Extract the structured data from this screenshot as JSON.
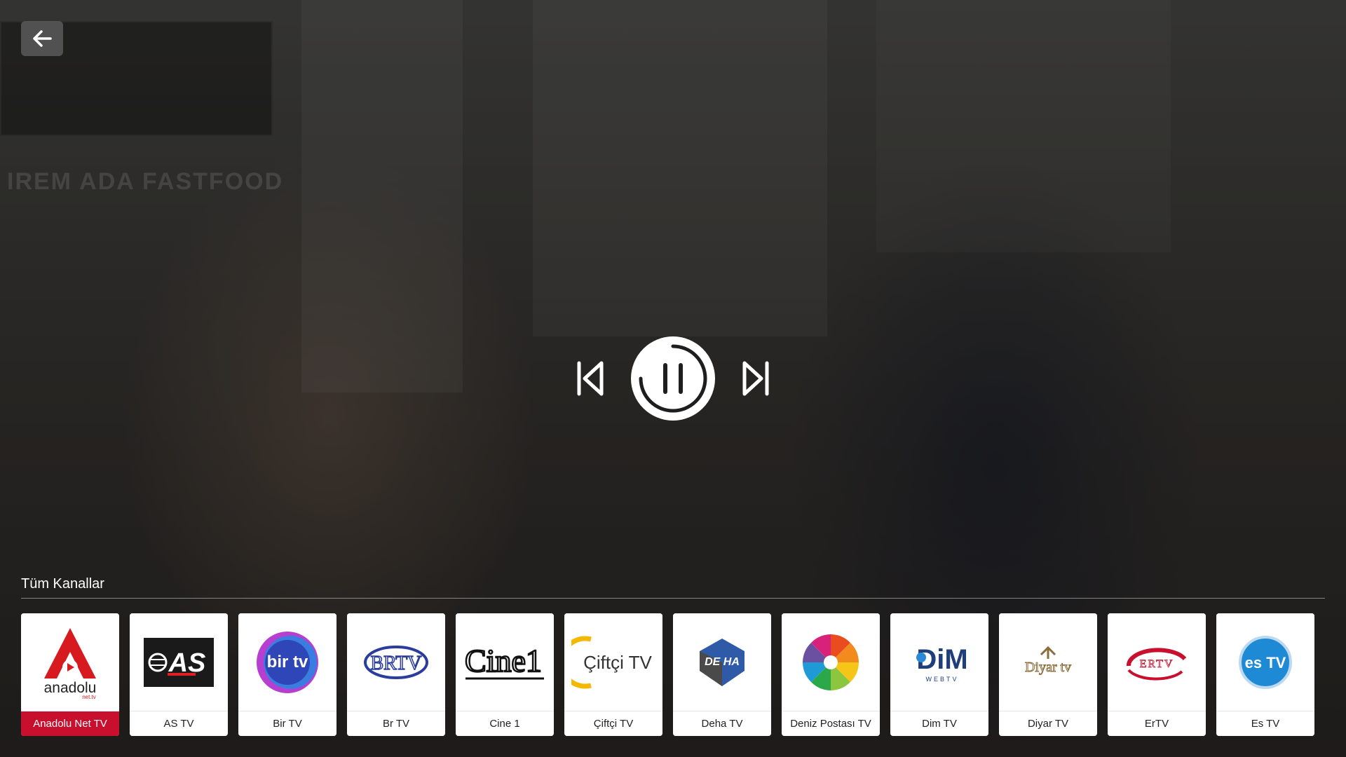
{
  "player": {
    "back_label": "back",
    "background_caption": "IREM ADA FASTFOOD",
    "status": "playing"
  },
  "channel_strip": {
    "title": "Tüm Kanallar",
    "selected_index": 0,
    "channels": [
      {
        "name": "Anadolu Net TV",
        "logo_text": "anadolu",
        "logo_sub": "net.tv",
        "accent": "#d71920"
      },
      {
        "name": "AS TV",
        "logo_text": "AS",
        "accent": "#e31e24"
      },
      {
        "name": "Bir TV",
        "logo_text": "bir tv",
        "accent": "#3a5bd9"
      },
      {
        "name": "Br TV",
        "logo_text": "BRTV",
        "accent": "#2a3c9e"
      },
      {
        "name": "Cine 1",
        "logo_text": "Cine1",
        "accent": "#111111"
      },
      {
        "name": "Çiftçi TV",
        "logo_text": "Çiftçi TV",
        "accent": "#f5b800"
      },
      {
        "name": "Deha TV",
        "logo_text": "DE HA",
        "accent": "#2f5aa8"
      },
      {
        "name": "Deniz Postası TV",
        "logo_text": "",
        "accent": "#e84c1f"
      },
      {
        "name": "Dim TV",
        "logo_text": "DiM",
        "logo_sub": "WEBTV",
        "accent": "#1f3f7a"
      },
      {
        "name": "Diyar TV",
        "logo_text": "Diyar tv",
        "accent": "#8a6d3b"
      },
      {
        "name": "ErTV",
        "logo_text": "ERTV",
        "accent": "#c8102e"
      },
      {
        "name": "Es TV",
        "logo_text": "es TV",
        "accent": "#1e8ad6"
      }
    ]
  }
}
